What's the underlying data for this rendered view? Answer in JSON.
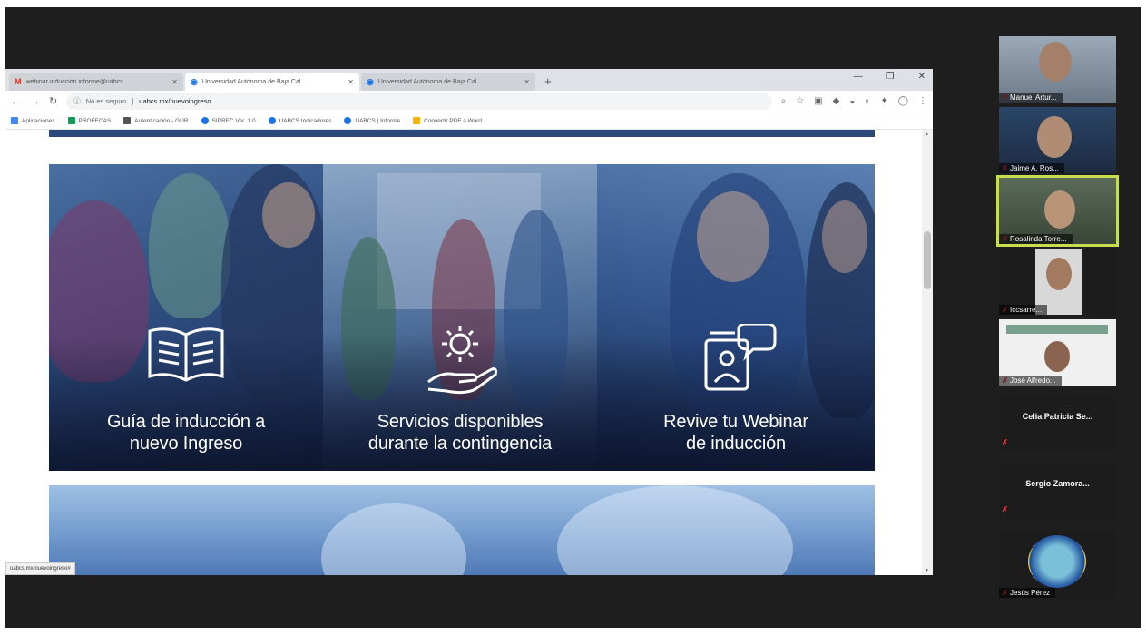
{
  "browser": {
    "tabs": [
      {
        "title": "webinar inducción informe@uabcs",
        "icon": "gmail-icon",
        "active": false
      },
      {
        "title": "Universidad Autónoma de Baja Cal",
        "icon": "globe-icon",
        "active": true
      },
      {
        "title": "Universidad Autónoma de Baja Cal",
        "icon": "globe-icon",
        "active": false
      }
    ],
    "new_tab": "+",
    "window_controls": [
      "—",
      "❐",
      "✕"
    ],
    "address": {
      "security": "No es seguro",
      "url": "uabcs.mx/nuevoingreso"
    },
    "bookmarks": [
      {
        "label": "Aplicaciones",
        "color": "#4285f4"
      },
      {
        "label": "PROFECAS",
        "color": "#0f9d58"
      },
      {
        "label": "Autenticación - GUR",
        "color": "#555555"
      },
      {
        "label": "SIPREC Ver. 1.0",
        "color": "#1a73e8"
      },
      {
        "label": "UABCS Indicadores",
        "color": "#1a73e8"
      },
      {
        "label": "UABCS | Informe",
        "color": "#1a73e8"
      },
      {
        "label": "Convertir PDF a Word...",
        "color": "#f4b400"
      }
    ],
    "status_url": "uabcs.mx/nuevoingreso#"
  },
  "page": {
    "cards": [
      {
        "icon": "open-book-icon",
        "line1": "Guía de inducción a",
        "line2": "nuevo Ingreso"
      },
      {
        "icon": "gear-hand-icon",
        "line1": "Servicios  disponibles",
        "line2": "durante la contingencia"
      },
      {
        "icon": "webinar-chat-icon",
        "line1": "Revive tu Webinar",
        "line2": "de inducción"
      }
    ]
  },
  "participants": [
    {
      "name": "Manuel Artur...",
      "type": "video"
    },
    {
      "name": "Jaime A. Ros...",
      "type": "video"
    },
    {
      "name": "Rosalinda Torre...",
      "type": "video",
      "active": true
    },
    {
      "name": "Iccsarre...",
      "type": "video"
    },
    {
      "name": "José Alfredo...",
      "type": "video"
    },
    {
      "name": "Celia Patricia Se...",
      "type": "text"
    },
    {
      "name": "Sergio Zamora...",
      "type": "text"
    },
    {
      "name": "Jesús Pérez",
      "type": "video"
    }
  ],
  "colors": {
    "accent_active": "#c8dc50",
    "muted_mic": "#e34040",
    "hero_dark": "#0f1d38"
  }
}
